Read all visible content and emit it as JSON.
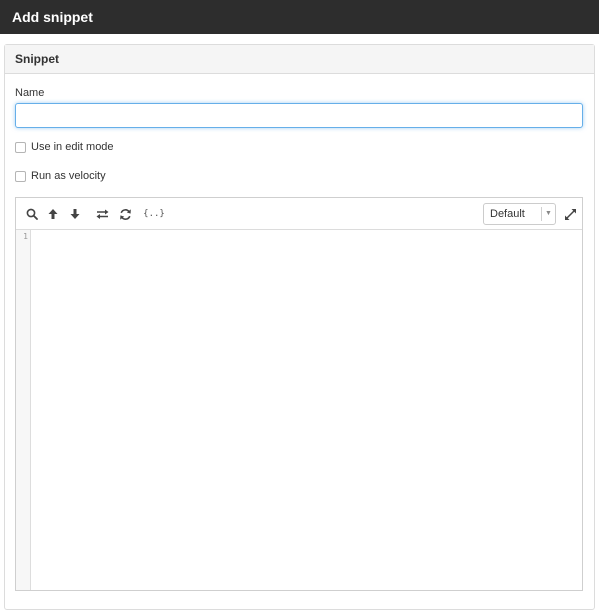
{
  "window": {
    "title": "Add snippet"
  },
  "panel": {
    "title": "Snippet"
  },
  "form": {
    "name_label": "Name",
    "name_value": "",
    "name_placeholder": "",
    "edit_mode_label": "Use in edit mode",
    "edit_mode_checked": false,
    "velocity_label": "Run as velocity",
    "velocity_checked": false
  },
  "editor": {
    "toolbar_icons": [
      "search-icon",
      "arrow-up-icon",
      "arrow-down-icon",
      "swap-icon",
      "refresh-icon",
      "braces-icon"
    ],
    "braces_glyph": "{..}",
    "theme_value": "Default",
    "dropdown_arrow": "▼",
    "fullscreen_icon": "expand-icon",
    "line_numbers": [
      "1"
    ]
  },
  "colors": {
    "titlebar_bg": "#2d2d2d",
    "input_focus": "#66afe9",
    "panel_header_bg": "#f5f5f5"
  }
}
